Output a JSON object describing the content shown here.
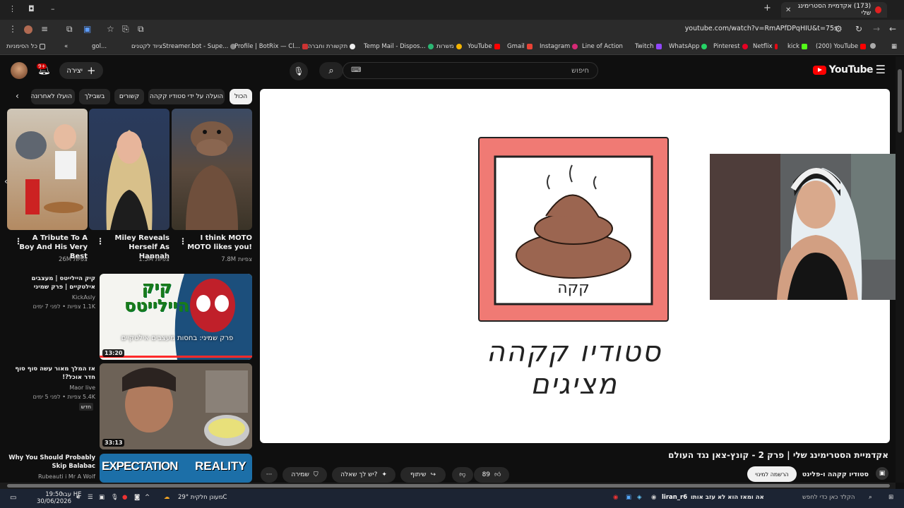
{
  "browser": {
    "tab_title": "(173) אקדמיית הסטרימינג שלי",
    "url": "youtube.com/watch?v=RmAPfDPqHIU&t=75s",
    "bookmarks": [
      "כל הסימניות",
      "gol...",
      "ציוד לקטנים",
      "Streamer.bot - Supe...",
      "Profile | BotRix — Cl...",
      "תקשורת וחברה",
      "Temp Mail - Dispos...",
      "משרות",
      "YouTube",
      "Gmail",
      "Instagram",
      "Line of Action",
      "Twitch",
      "WhatsApp",
      "Pinterest",
      "Netflix",
      "kick",
      "(200) YouTube"
    ]
  },
  "header": {
    "logo_text": "YouTube",
    "search_placeholder": "חיפוש",
    "create_label": "יצירה",
    "notification_count": "9+"
  },
  "chips": [
    "הכול",
    "הועלה על ידי סטודיו קקהה",
    "קשורים",
    "בשבילך",
    "הועלו לאחרונה"
  ],
  "shorts": [
    {
      "title": "I think MOTO MOTO likes you!",
      "views": "7.8M צפיות"
    },
    {
      "title": "Miley Reveals Herself As Hannah",
      "views": "1.5M צפיות"
    },
    {
      "title": "A Tribute To A Boy And His Very Best",
      "views": "26M צפיות"
    }
  ],
  "related": [
    {
      "title": "קיק היילייטס | מעצבים אילטקיים | פרק שמיני",
      "channel": "KickAsly",
      "meta": "1.1K צפיות • לפני 7 ימים",
      "duration": "13:20",
      "thumb_text_big": "קיק היילייטס",
      "thumb_text_small": "פרק שמיני: בחסות מעצבים אילטקיים"
    },
    {
      "title": "אז המלך מאור עשה סוף סוף חדר אוכל?!",
      "channel": "Maor live",
      "meta": "5.4K צפיות • לפני 5 ימים",
      "badge": "חדש",
      "duration": "33:13"
    },
    {
      "title": "Why You Should Probably Skip Balabac",
      "channel": "Rubeauti i Mr A Wolf",
      "thumb_left": "EXPECTATION",
      "thumb_right": "REALITY"
    }
  ],
  "player": {
    "logo_caption": "קקה",
    "logo_title": "סטודיו קקהה מציגים"
  },
  "video": {
    "title": "אקדמיית הסטרימינג שלי | פרק 2 - קונץ-צאן נגד העולם",
    "channel": "סטודיו קקהה ו-פלינט",
    "member_label": "הרשמה למינוי",
    "likes": "89",
    "share_label": "שיתוף",
    "ask_label": "יש לך שאלה?",
    "save_label": "שמירה"
  },
  "taskbar": {
    "search_placeholder": "הקלד כאן כדי לחפש",
    "ticker": "אה ומאז הוא לא עזב אותו",
    "user": "liran_r6",
    "weather": "מעונן חלקית 29°C",
    "lang": "עבר HE",
    "time": "19:50",
    "date": "30/06/2026"
  },
  "colors": {
    "yt_red": "#ff0000",
    "logo_frame": "#f07a74",
    "logo_poop": "#9b6550"
  }
}
